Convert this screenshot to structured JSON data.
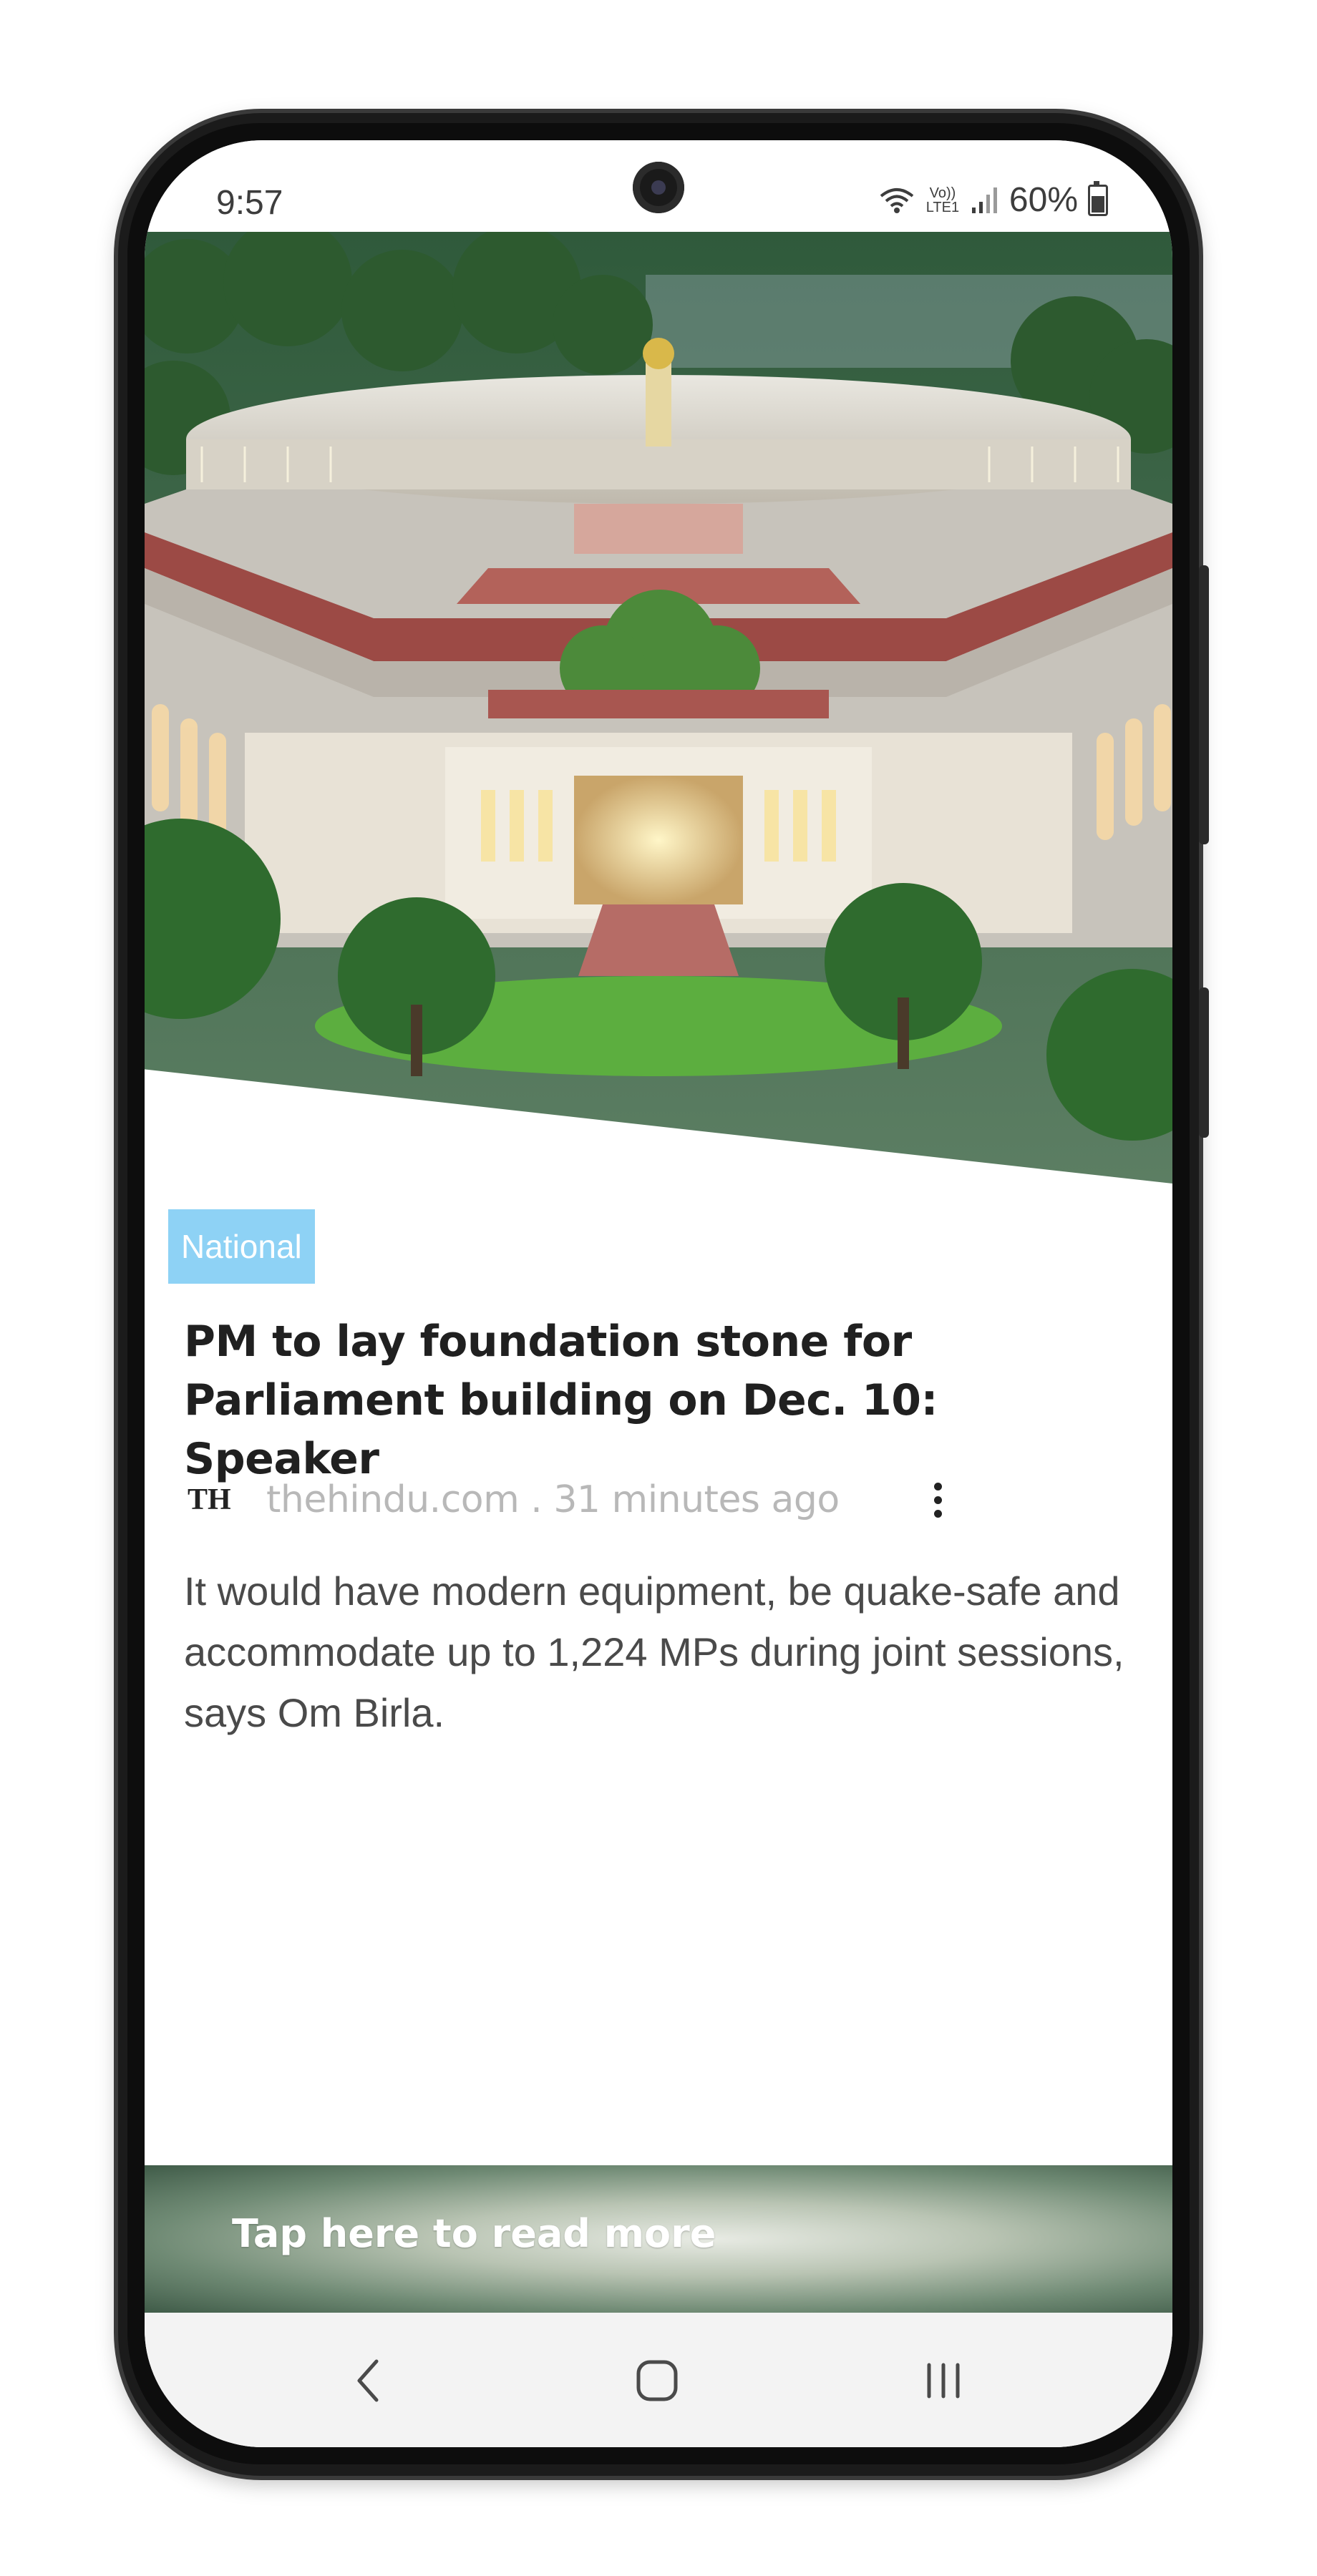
{
  "status_bar": {
    "time": "9:57",
    "network_label": "Vo)) LTE1",
    "battery": "60%",
    "battery_level": 0.6
  },
  "hero": {
    "icon": "parliament-building-image"
  },
  "article": {
    "category": "National",
    "headline": "PM to lay foundation stone for Parliament building on Dec. 10: Speaker",
    "source_logo": "TH",
    "source_meta": "thehindu.com . 31 minutes ago",
    "summary": "It would have modern equipment, be quake-safe and accommodate up to 1,224 MPs during joint sessions, says Om Birla."
  },
  "read_more": {
    "label": "Tap here to read more"
  },
  "navbar": {
    "back_icon": "back-chevron-icon",
    "home_icon": "home-icon",
    "recents_icon": "recents-icon"
  },
  "colors": {
    "category_badge": "#8ed2f5",
    "headline": "#202020",
    "summary": "#4a4a4a",
    "meta": "#b8b8b8"
  }
}
